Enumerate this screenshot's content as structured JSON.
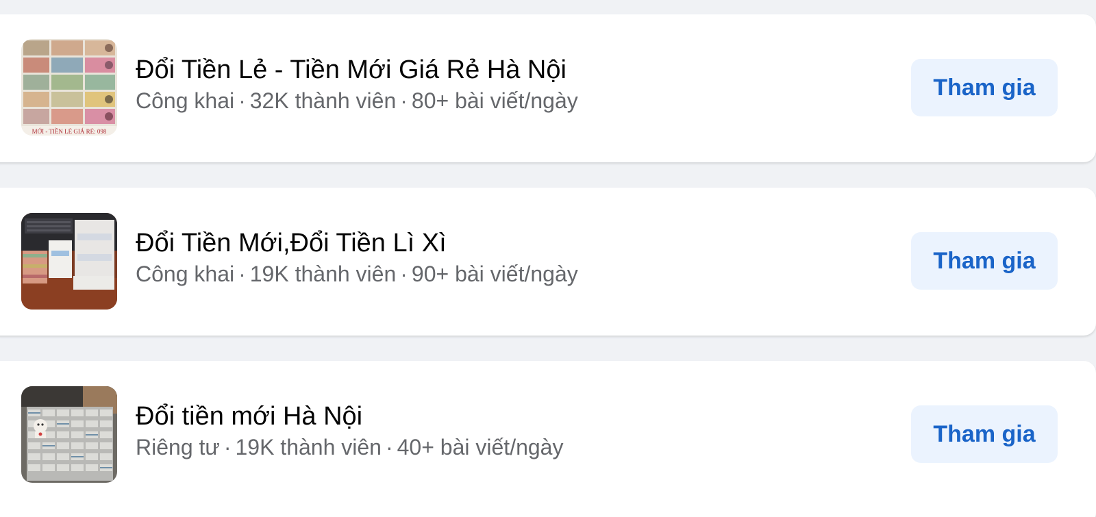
{
  "groups": [
    {
      "name": "Đổi Tiền Lẻ - Tiền Mới Giá Rẻ Hà Nội",
      "privacy": "Công khai",
      "members": "32K thành viên",
      "posts": "80+ bài viết/ngày",
      "join_label": "Tham gia",
      "thumb_caption": "MỚI - TIỀN LẺ GIÁ RẺ: 098"
    },
    {
      "name": "Đổi Tiền Mới,Đổi Tiền Lì Xì",
      "privacy": "Công khai",
      "members": "19K thành viên",
      "posts": "90+ bài viết/ngày",
      "join_label": "Tham gia"
    },
    {
      "name": "Đổi tiền mới Hà Nội",
      "privacy": "Riêng tư",
      "members": "19K thành viên",
      "posts": "40+ bài viết/ngày",
      "join_label": "Tham gia"
    }
  ],
  "separator": "·",
  "colors": {
    "background": "#f0f2f5",
    "card": "#ffffff",
    "title": "#050505",
    "meta": "#65676b",
    "button_bg": "#ebf3fe",
    "button_text": "#1a64c8"
  }
}
